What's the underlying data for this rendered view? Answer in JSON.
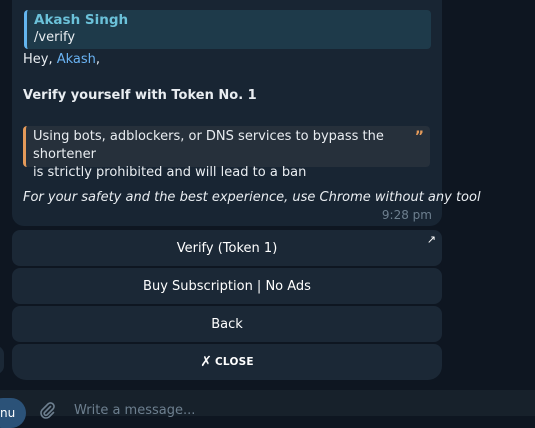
{
  "message": {
    "reply": {
      "sender": "Akash Singh",
      "text": "/verify"
    },
    "greeting_prefix": "Hey, ",
    "greeting_name": "Akash",
    "greeting_suffix": ",",
    "heading": "Verify yourself with Token No. 1",
    "quote": {
      "line1": "Using bots, adblockers, or DNS services to bypass the shortener",
      "line2": "is strictly prohibited and will lead to a ban",
      "mark": "”"
    },
    "note": "For your safety and the best experience, use Chrome without any tool",
    "time": "9:28 pm"
  },
  "keyboard": {
    "verify": "Verify (Token 1)",
    "verify_icon": "↗",
    "subscription": "Buy Subscription | No Ads",
    "back": "Back",
    "close_icon": "✗",
    "close": "CLOSE"
  },
  "composer": {
    "menu_label": "nu",
    "placeholder": "Write a message..."
  },
  "colors": {
    "background": "#0e1621",
    "bubble": "#182533",
    "mention": "#6ab3f3",
    "quote_accent": "#e49a5a",
    "reply_accent": "#64b5ef"
  }
}
